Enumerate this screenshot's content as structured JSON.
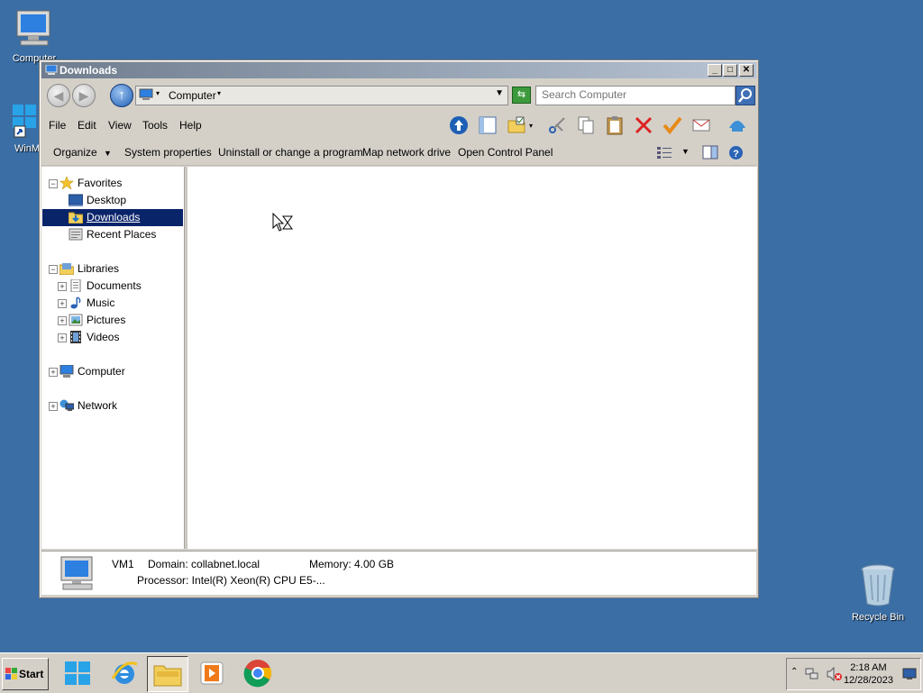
{
  "desktop": {
    "icons": [
      {
        "label": "Computer"
      },
      {
        "label": "WinM"
      },
      {
        "label": "Recycle Bin"
      }
    ]
  },
  "window": {
    "title": "Downloads",
    "address": {
      "crumb": "Computer"
    },
    "search": {
      "placeholder": "Search Computer"
    },
    "menu": [
      "File",
      "Edit",
      "View",
      "Tools",
      "Help"
    ],
    "commands": [
      "Organize",
      "System properties",
      "Uninstall or change a program",
      "Map network drive",
      "Open Control Panel"
    ],
    "nav": {
      "favorites": "Favorites",
      "desktop": "Desktop",
      "downloads": "Downloads",
      "recent": "Recent Places",
      "libraries": "Libraries",
      "documents": "Documents",
      "music": "Music",
      "pictures": "Pictures",
      "videos": "Videos",
      "computer": "Computer",
      "network": "Network"
    },
    "details": {
      "name": "VM1",
      "domain": "Domain: collabnet.local",
      "memory": "Memory: 4.00 GB",
      "processor": "Processor: Intel(R) Xeon(R) CPU E5-..."
    }
  },
  "taskbar": {
    "start": "Start",
    "time": "2:18 AM",
    "date": "12/28/2023"
  },
  "colors": {
    "desktop": "#3a6ea5",
    "selection": "#0a246a"
  }
}
